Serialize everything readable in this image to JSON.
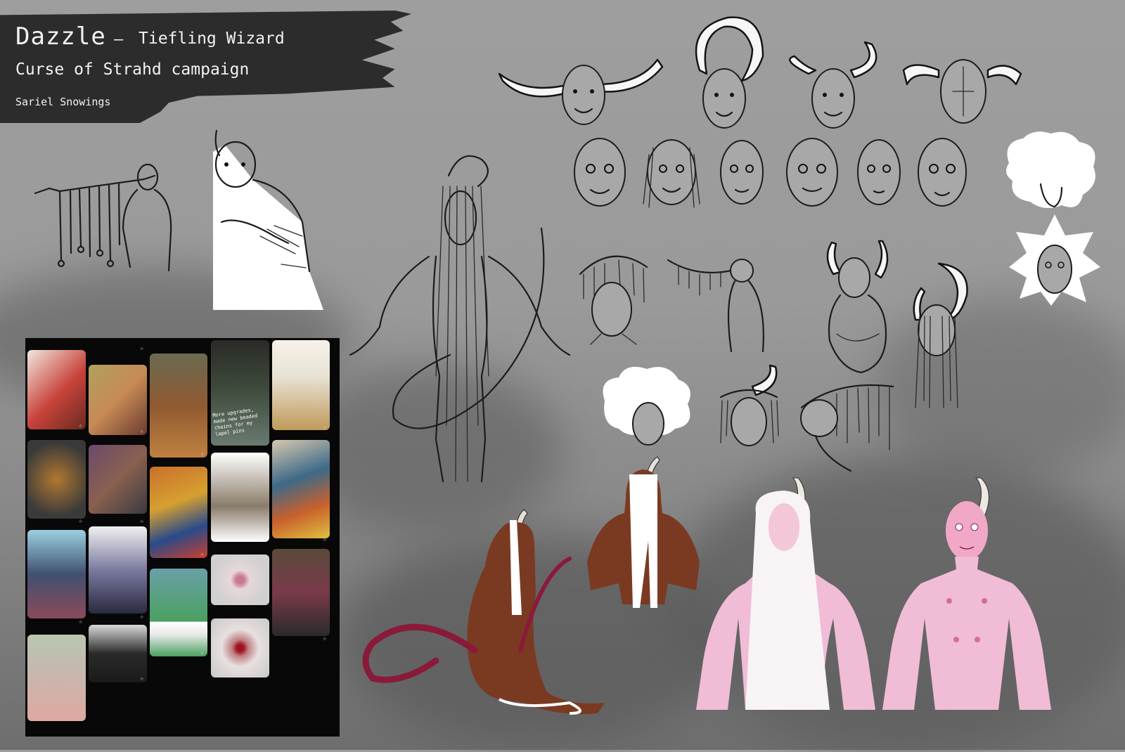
{
  "header": {
    "character_name": "Dazzle",
    "separator": "–",
    "subtitle": "Tiefling Wizard",
    "campaign": "Curse of Strahd campaign",
    "artist": "Sariel Snowings"
  },
  "moodboard": {
    "caption": "More upgrades, made new beaded chains for my lapel pins",
    "tile_colors": [
      "#c8433a",
      "#c78a55",
      "#8f5a32",
      "#3d4a3a",
      "#e8e2d5",
      "#b07830",
      "#6a4a6c",
      "#c9702c",
      "#8a7c6a",
      "#3d6a88",
      "#405070",
      "#7a7aa0",
      "#4aa0b0",
      "#444444",
      "#d0d0d0",
      "#7a3a4a",
      "#c5b8b0",
      "#2a2a2a",
      "#c08080"
    ],
    "star_glyph": "☆"
  },
  "colors": {
    "background": "#9e9e9e",
    "banner": "#2c2c2c",
    "skin_brown": "#7a3a22",
    "skin_pink": "#f0bcd6",
    "tail_red": "#8a1a3a"
  }
}
